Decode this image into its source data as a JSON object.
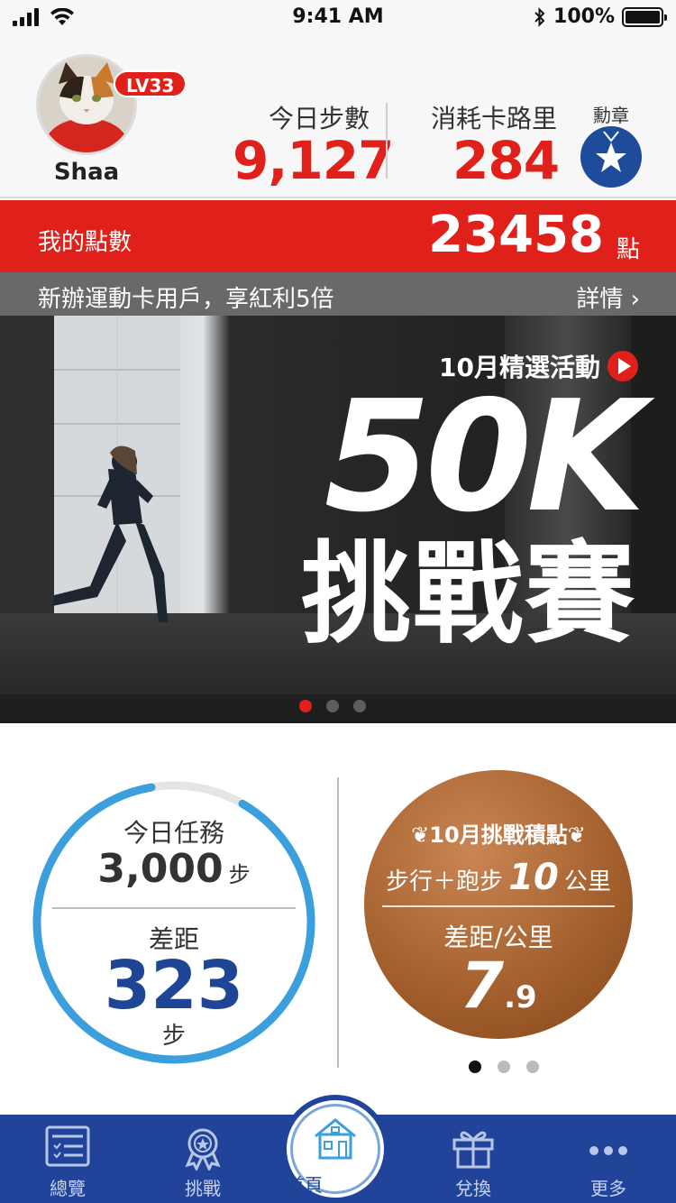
{
  "status_bar": {
    "time": "9:41 AM",
    "battery": "100%"
  },
  "profile": {
    "username": "Shaa",
    "level": "LV33",
    "steps_label": "今日步數",
    "steps_value": "9,127",
    "calories_label": "消耗卡路里",
    "calories_value": "284",
    "medal_label": "勳章"
  },
  "points": {
    "label": "我的點數",
    "value": "23458",
    "unit": "點"
  },
  "banner": {
    "promo_text": "新辦運動卡用戶，享紅利5倍",
    "promo_link": "詳情 ›",
    "featured_label": "10月精選活動",
    "title": "50K",
    "subtitle": "挑戰賽",
    "slide_count": 3,
    "active_slide": 1
  },
  "task": {
    "label": "今日任務",
    "target": "3,000",
    "target_unit": "步",
    "gap_label": "差距",
    "gap_value": "323",
    "gap_unit": "步",
    "progress": 0.89
  },
  "challenge": {
    "title": "❦10月挑戰積點❦",
    "line1_prefix": "步行＋跑步",
    "line1_number": "10",
    "line1_unit": "公里",
    "gap_label": "差距/公里",
    "gap_int": "7",
    "gap_dec": ".9",
    "page_count": 3,
    "active_page": 1
  },
  "tabs": {
    "overview": "總覽",
    "challenge": "挑戰",
    "home": "首頁",
    "redeem": "兌換",
    "more": "更多"
  },
  "colors": {
    "brand_red": "#e0201b",
    "brand_blue": "#21449a",
    "ring_blue": "#3a9fdc",
    "bronze": "#a5612e"
  }
}
